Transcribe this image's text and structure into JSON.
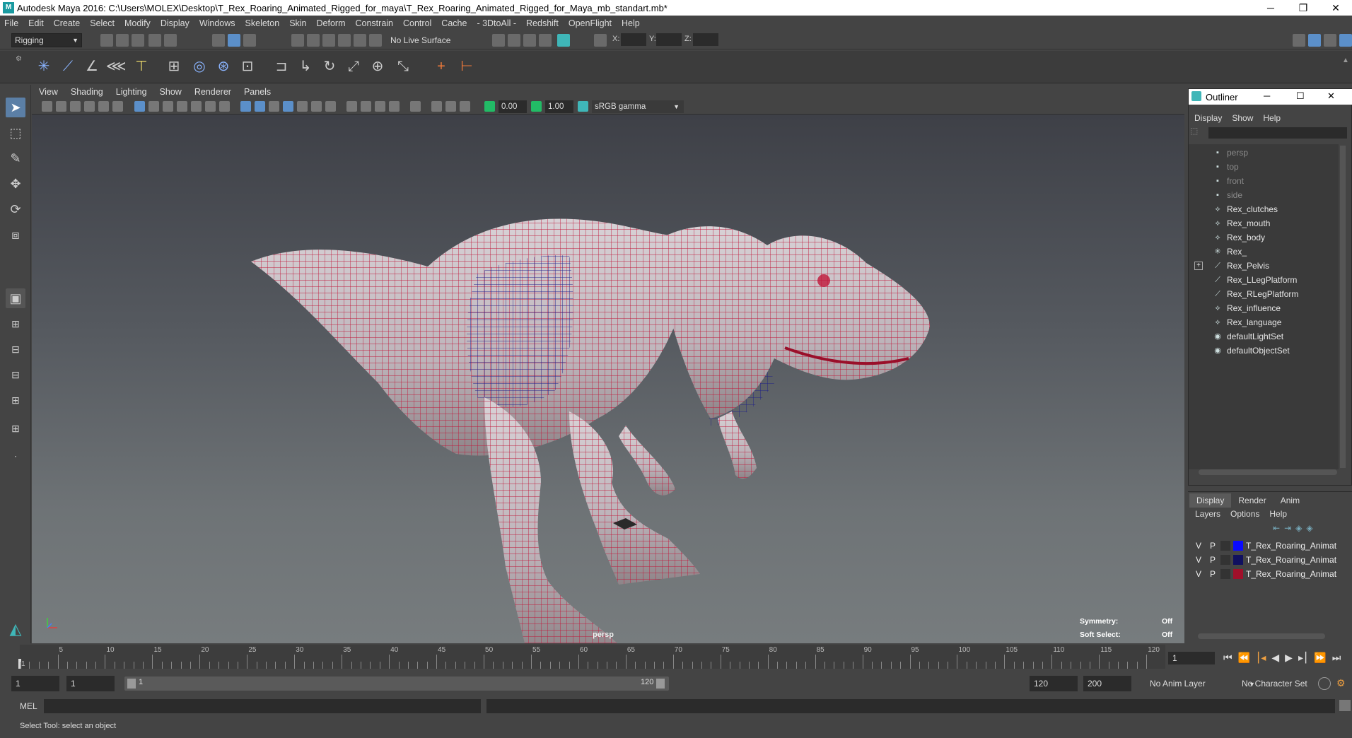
{
  "window": {
    "title": "Autodesk Maya 2016: C:\\Users\\MOLEX\\Desktop\\T_Rex_Roaring_Animated_Rigged_for_maya\\T_Rex_Roaring_Animated_Rigged_for_Maya_mb_standart.mb*",
    "minimize": "─",
    "restore": "❐",
    "close": "✕"
  },
  "menubar": [
    "File",
    "Edit",
    "Create",
    "Select",
    "Modify",
    "Display",
    "Windows",
    "Skeleton",
    "Skin",
    "Deform",
    "Constrain",
    "Control",
    "Cache",
    "- 3DtoAll -",
    "Redshift",
    "OpenFlight",
    "Help"
  ],
  "statusline": {
    "menuset": "Rigging",
    "live_surface": "No Live Surface",
    "x_label": "X:",
    "y_label": "Y:",
    "z_label": "Z:"
  },
  "viewport": {
    "menus": [
      "View",
      "Shading",
      "Lighting",
      "Show",
      "Renderer",
      "Panels"
    ],
    "exposure": "0.00",
    "gamma": "1.00",
    "color_space": "sRGB gamma",
    "camera": "persp",
    "symmetry_label": "Symmetry:",
    "symmetry_value": "Off",
    "soft_select_label": "Soft Select:",
    "soft_select_value": "Off"
  },
  "outliner": {
    "title": "Outliner",
    "menus": [
      "Display",
      "Show",
      "Help"
    ],
    "items": [
      {
        "label": "persp",
        "icon": "camera-icon",
        "dim": true
      },
      {
        "label": "top",
        "icon": "camera-icon",
        "dim": true
      },
      {
        "label": "front",
        "icon": "camera-icon",
        "dim": true
      },
      {
        "label": "side",
        "icon": "camera-icon",
        "dim": true
      },
      {
        "label": "Rex_clutches",
        "icon": "mesh-icon",
        "dim": false
      },
      {
        "label": "Rex_mouth",
        "icon": "mesh-icon",
        "dim": false
      },
      {
        "label": "Rex_body",
        "icon": "mesh-icon",
        "dim": false
      },
      {
        "label": "Rex_",
        "icon": "locator-icon",
        "dim": false
      },
      {
        "label": "Rex_Pelvis",
        "icon": "joint-icon",
        "dim": false,
        "expand": "+"
      },
      {
        "label": "Rex_LLegPlatform",
        "icon": "joint-icon",
        "dim": false
      },
      {
        "label": "Rex_RLegPlatform",
        "icon": "joint-icon",
        "dim": false
      },
      {
        "label": "Rex_influence",
        "icon": "mesh-icon",
        "dim": false
      },
      {
        "label": "Rex_language",
        "icon": "mesh-icon",
        "dim": false
      },
      {
        "label": "defaultLightSet",
        "icon": "set-icon",
        "dim": false
      },
      {
        "label": "defaultObjectSet",
        "icon": "set-icon",
        "dim": false
      }
    ]
  },
  "layer_editor": {
    "tabs": [
      "Display",
      "Render",
      "Anim"
    ],
    "menus": [
      "Layers",
      "Options",
      "Help"
    ],
    "layers": [
      {
        "v": "V",
        "p": "P",
        "color": "#0a0aff",
        "name": "T_Rex_Roaring_Animat"
      },
      {
        "v": "V",
        "p": "P",
        "color": "#101060",
        "name": "T_Rex_Roaring_Animat"
      },
      {
        "v": "V",
        "p": "P",
        "color": "#a0102a",
        "name": "T_Rex_Roaring_Animat"
      }
    ]
  },
  "timeline": {
    "ticks": [
      "1",
      "5",
      "10",
      "15",
      "20",
      "25",
      "30",
      "35",
      "40",
      "45",
      "50",
      "55",
      "60",
      "65",
      "70",
      "75",
      "80",
      "85",
      "90",
      "95",
      "100",
      "105",
      "110",
      "115",
      "120"
    ],
    "current_frame": "1"
  },
  "range": {
    "start": "1",
    "playback_start": "1",
    "slider_start": "1",
    "slider_end": "120",
    "playback_end": "120",
    "end": "200",
    "anim_layer": "No Anim Layer",
    "character_set": "No Character Set"
  },
  "cmdline": {
    "label": "MEL"
  },
  "helpline": {
    "text": "Select Tool: select an object"
  }
}
